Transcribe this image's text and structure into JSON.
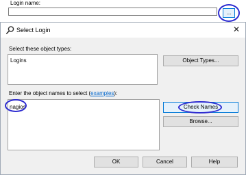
{
  "background": {
    "login_label": "Login name:",
    "browse_label": "...",
    "login_value": ""
  },
  "dialog": {
    "title": "Select Login",
    "close_glyph": "✕",
    "object_types_label": "Select these object types:",
    "object_types_value": "Logins",
    "object_types_button": "Object Types...",
    "names_label_prefix": "Enter the object names to select (",
    "names_label_link": "examples",
    "names_label_suffix": "):",
    "names_value": "nagios",
    "check_names_button": "Check Names",
    "browse_button": "Browse...",
    "ok_button": "OK",
    "cancel_button": "Cancel",
    "help_button": "Help"
  },
  "colors": {
    "highlight_ring": "#2d2bd0",
    "dialog_bg": "#f0f0f0",
    "link": "#0066cc"
  },
  "icons": {
    "title_icon": "search-icon"
  }
}
